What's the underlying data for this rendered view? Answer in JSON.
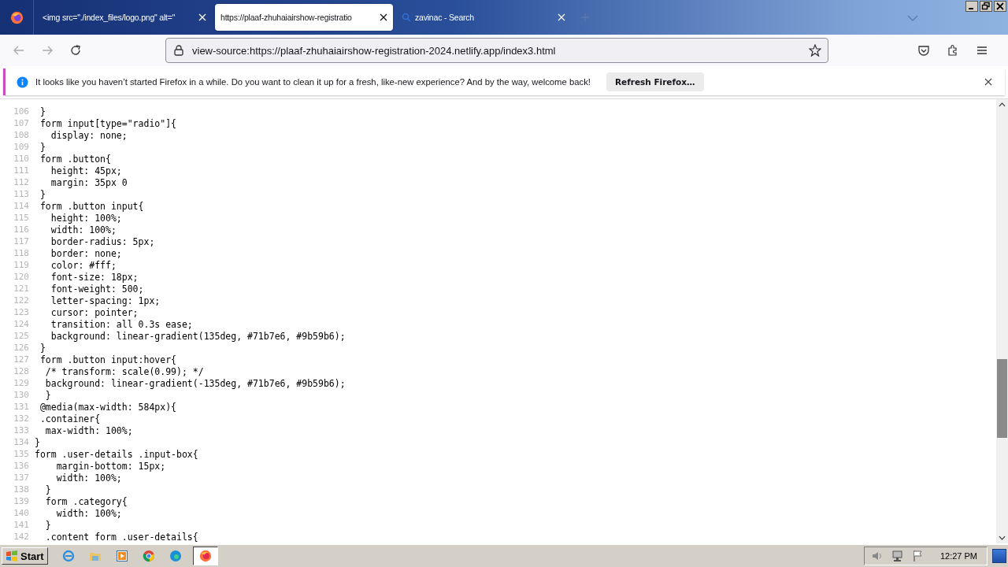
{
  "tabs": [
    {
      "title": "<img src=\"./index_files/logo.png\" alt=\"",
      "selected": false
    },
    {
      "title": "https://plaaf-zhuhaiairshow-registratio",
      "selected": true
    },
    {
      "title": "zavinac - Search",
      "selected": false
    }
  ],
  "address_bar": {
    "url": "view-source:https://plaaf-zhuhaiairshow-registration-2024.netlify.app/index3.html"
  },
  "notification": {
    "message": "It looks like you haven’t started Firefox in a while. Do you want to clean it up for a fresh, like-new experience? And by the way, welcome back!",
    "button": "Refresh Firefox…"
  },
  "source_lines": [
    {
      "number": "106",
      "text": " }"
    },
    {
      "number": "107",
      "text": " form input[type=\"radio\"]{"
    },
    {
      "number": "108",
      "text": "   display: none;"
    },
    {
      "number": "109",
      "text": " }"
    },
    {
      "number": "110",
      "text": " form .button{"
    },
    {
      "number": "111",
      "text": "   height: 45px;"
    },
    {
      "number": "112",
      "text": "   margin: 35px 0"
    },
    {
      "number": "113",
      "text": " }"
    },
    {
      "number": "114",
      "text": " form .button input{"
    },
    {
      "number": "115",
      "text": "   height: 100%;"
    },
    {
      "number": "116",
      "text": "   width: 100%;"
    },
    {
      "number": "117",
      "text": "   border-radius: 5px;"
    },
    {
      "number": "118",
      "text": "   border: none;"
    },
    {
      "number": "119",
      "text": "   color: #fff;"
    },
    {
      "number": "120",
      "text": "   font-size: 18px;"
    },
    {
      "number": "121",
      "text": "   font-weight: 500;"
    },
    {
      "number": "122",
      "text": "   letter-spacing: 1px;"
    },
    {
      "number": "123",
      "text": "   cursor: pointer;"
    },
    {
      "number": "124",
      "text": "   transition: all 0.3s ease;"
    },
    {
      "number": "125",
      "text": "   background: linear-gradient(135deg, #71b7e6, #9b59b6);"
    },
    {
      "number": "126",
      "text": " }"
    },
    {
      "number": "127",
      "text": " form .button input:hover{"
    },
    {
      "number": "128",
      "text": "  /* transform: scale(0.99); */"
    },
    {
      "number": "129",
      "text": "  background: linear-gradient(-135deg, #71b7e6, #9b59b6);"
    },
    {
      "number": "130",
      "text": "  }"
    },
    {
      "number": "131",
      "text": " @media(max-width: 584px){"
    },
    {
      "number": "132",
      "text": " .container{"
    },
    {
      "number": "133",
      "text": "  max-width: 100%;"
    },
    {
      "number": "134",
      "text": "}"
    },
    {
      "number": "135",
      "text": "form .user-details .input-box{"
    },
    {
      "number": "136",
      "text": "    margin-bottom: 15px;"
    },
    {
      "number": "137",
      "text": "    width: 100%;"
    },
    {
      "number": "138",
      "text": "  }"
    },
    {
      "number": "139",
      "text": "  form .category{"
    },
    {
      "number": "140",
      "text": "    width: 100%;"
    },
    {
      "number": "141",
      "text": "  }"
    },
    {
      "number": "142",
      "text": "  .content form .user-details{"
    }
  ],
  "taskbar": {
    "start": "Start",
    "clock": "12:27 PM"
  }
}
